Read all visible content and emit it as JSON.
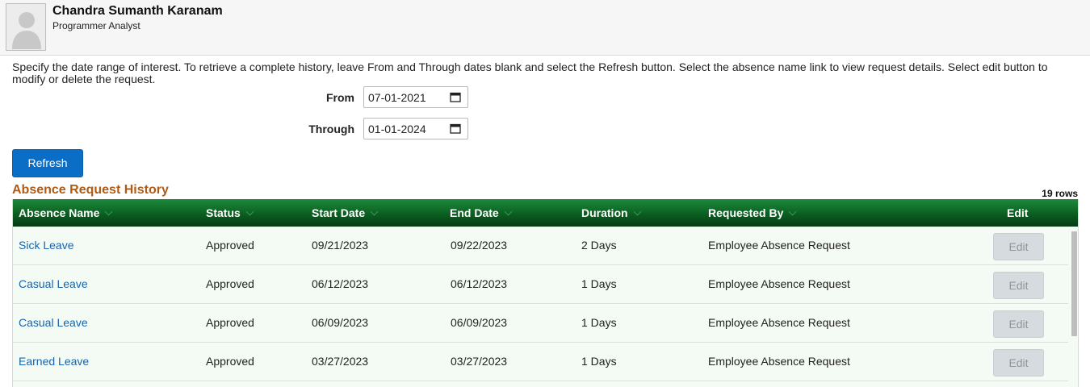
{
  "header": {
    "name": "Chandra Sumanth Karanam",
    "title": "Programmer Analyst"
  },
  "instructions": "Specify the date range of interest. To retrieve a complete history, leave From and Through dates blank and select the Refresh button. Select the absence name link to view request details. Select edit button to modify or delete the request.",
  "filters": {
    "from_label": "From",
    "from_value": "07-01-2021",
    "through_label": "Through",
    "through_value": "01-01-2024"
  },
  "refresh_label": "Refresh",
  "section_title": "Absence Request History",
  "row_count": "19 rows",
  "table": {
    "columns": [
      "Absence Name",
      "Status",
      "Start Date",
      "End Date",
      "Duration",
      "Requested By",
      "Edit"
    ],
    "rows": [
      {
        "name": "Sick Leave",
        "status": "Approved",
        "start": "09/21/2023",
        "end": "09/22/2023",
        "duration": "2 Days",
        "requested_by": "Employee Absence Request",
        "edit": "Edit"
      },
      {
        "name": "Casual Leave",
        "status": "Approved",
        "start": "06/12/2023",
        "end": "06/12/2023",
        "duration": "1 Days",
        "requested_by": "Employee Absence Request",
        "edit": "Edit"
      },
      {
        "name": "Casual Leave",
        "status": "Approved",
        "start": "06/09/2023",
        "end": "06/09/2023",
        "duration": "1 Days",
        "requested_by": "Employee Absence Request",
        "edit": "Edit"
      },
      {
        "name": "Earned Leave",
        "status": "Approved",
        "start": "03/27/2023",
        "end": "03/27/2023",
        "duration": "1 Days",
        "requested_by": "Employee Absence Request",
        "edit": "Edit"
      }
    ]
  },
  "colors": {
    "accent": "#0a6ec6",
    "header_green": "#0b5e21",
    "section_title": "#b05a13",
    "link": "#1565b0"
  }
}
